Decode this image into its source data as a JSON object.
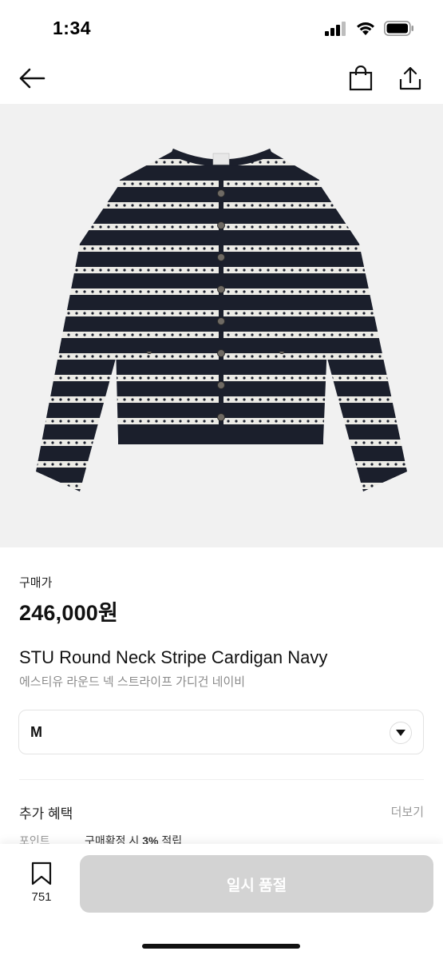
{
  "status_bar": {
    "time": "1:34"
  },
  "nav": {
    "back_icon": "arrow-left-icon",
    "bag_icon": "shopping-bag-icon",
    "share_icon": "share-icon"
  },
  "product": {
    "image_icon": "striped-cardigan-image",
    "price_label": "구매가",
    "price": "246,000원",
    "name_en": "STU Round Neck Stripe Cardigan Navy",
    "name_ko": "에스티유 라운드 넥 스트라이프 가디건 네이비"
  },
  "size_select": {
    "selected": "M",
    "icon": "chevron-down-icon"
  },
  "benefits": {
    "title": "추가 혜택",
    "more": "더보기",
    "row_label": "포인트",
    "row_prefix": "구매확정 시",
    "row_rate": "3%",
    "row_suffix": "적립"
  },
  "bottom_bar": {
    "bookmark_count": "751",
    "action_label": "일시 품절"
  },
  "colors": {
    "navy": "#1b1f2c",
    "button_disabled": "#d3d3d3",
    "hero_bg": "#f1f1f1"
  }
}
